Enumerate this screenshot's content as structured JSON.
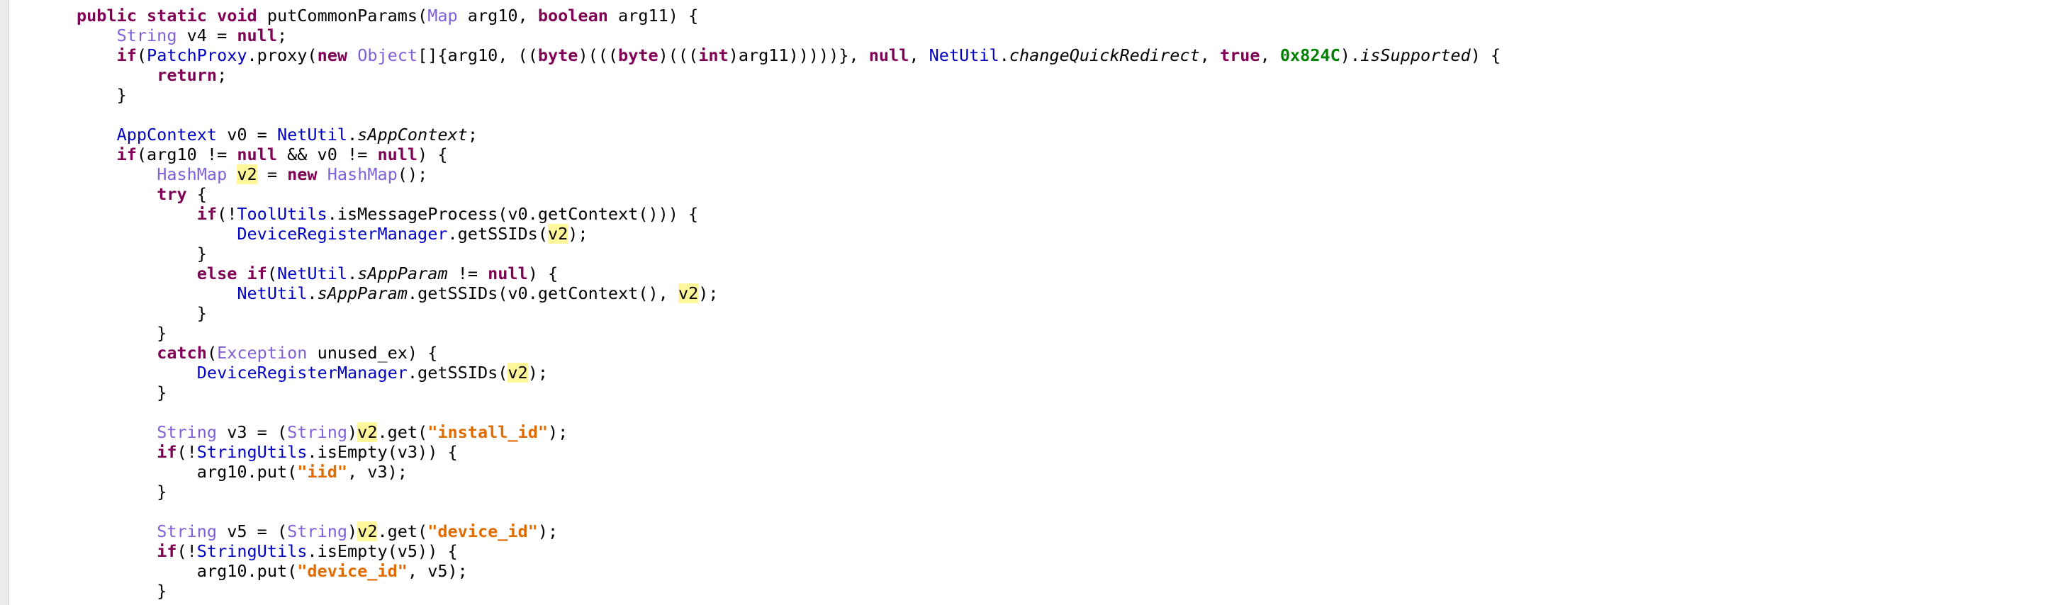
{
  "editor": {
    "lines": [
      [
        {
          "t": "public static void ",
          "c": "kw"
        },
        {
          "t": "putCommonParams("
        },
        {
          "t": "Map",
          "c": "ty"
        },
        {
          "t": " arg10, "
        },
        {
          "t": "boolean",
          "c": "kw"
        },
        {
          "t": " arg11) {"
        }
      ],
      [
        {
          "t": "    "
        },
        {
          "t": "String",
          "c": "ty"
        },
        {
          "t": " v4 = "
        },
        {
          "t": "null",
          "c": "kw"
        },
        {
          "t": ";"
        }
      ],
      [
        {
          "t": "    "
        },
        {
          "t": "if",
          "c": "kw"
        },
        {
          "t": "("
        },
        {
          "t": "PatchProxy",
          "c": "cls"
        },
        {
          "t": ".proxy("
        },
        {
          "t": "new",
          "c": "kw"
        },
        {
          "t": " "
        },
        {
          "t": "Object",
          "c": "ty"
        },
        {
          "t": "[]{arg10, (("
        },
        {
          "t": "byte",
          "c": "kw"
        },
        {
          "t": ")((("
        },
        {
          "t": "byte",
          "c": "kw"
        },
        {
          "t": ")((("
        },
        {
          "t": "int",
          "c": "kw"
        },
        {
          "t": ")arg11)))))}, "
        },
        {
          "t": "null",
          "c": "kw"
        },
        {
          "t": ", "
        },
        {
          "t": "NetUtil",
          "c": "cls"
        },
        {
          "t": "."
        },
        {
          "t": "changeQuickRedirect",
          "c": "it"
        },
        {
          "t": ", "
        },
        {
          "t": "true",
          "c": "kw"
        },
        {
          "t": ", "
        },
        {
          "t": "0x824C",
          "c": "num"
        },
        {
          "t": ")."
        },
        {
          "t": "isSupported",
          "c": "it"
        },
        {
          "t": ") {"
        }
      ],
      [
        {
          "t": "        "
        },
        {
          "t": "return",
          "c": "kw"
        },
        {
          "t": ";"
        }
      ],
      [
        {
          "t": "    }"
        }
      ],
      [
        {
          "t": ""
        }
      ],
      [
        {
          "t": "    "
        },
        {
          "t": "AppContext",
          "c": "cls"
        },
        {
          "t": " v0 = "
        },
        {
          "t": "NetUtil",
          "c": "cls"
        },
        {
          "t": "."
        },
        {
          "t": "sAppContext",
          "c": "it"
        },
        {
          "t": ";"
        }
      ],
      [
        {
          "t": "    "
        },
        {
          "t": "if",
          "c": "kw"
        },
        {
          "t": "(arg10 != "
        },
        {
          "t": "null",
          "c": "kw"
        },
        {
          "t": " && v0 != "
        },
        {
          "t": "null",
          "c": "kw"
        },
        {
          "t": ") {"
        }
      ],
      [
        {
          "t": "        "
        },
        {
          "t": "HashMap",
          "c": "ty"
        },
        {
          "t": " "
        },
        {
          "t": "v2",
          "c": "hl"
        },
        {
          "t": " = "
        },
        {
          "t": "new",
          "c": "kw"
        },
        {
          "t": " "
        },
        {
          "t": "HashMap",
          "c": "ty"
        },
        {
          "t": "();"
        }
      ],
      [
        {
          "t": "        "
        },
        {
          "t": "try",
          "c": "kw"
        },
        {
          "t": " {"
        }
      ],
      [
        {
          "t": "            "
        },
        {
          "t": "if",
          "c": "kw"
        },
        {
          "t": "(!"
        },
        {
          "t": "ToolUtils",
          "c": "cls"
        },
        {
          "t": ".isMessageProcess(v0.getContext())) {"
        }
      ],
      [
        {
          "t": "                "
        },
        {
          "t": "DeviceRegisterManager",
          "c": "cls"
        },
        {
          "t": ".getSSIDs("
        },
        {
          "t": "v2",
          "c": "hl"
        },
        {
          "t": ");"
        }
      ],
      [
        {
          "t": "            }"
        }
      ],
      [
        {
          "t": "            "
        },
        {
          "t": "else if",
          "c": "kw"
        },
        {
          "t": "("
        },
        {
          "t": "NetUtil",
          "c": "cls"
        },
        {
          "t": "."
        },
        {
          "t": "sAppParam",
          "c": "it"
        },
        {
          "t": " != "
        },
        {
          "t": "null",
          "c": "kw"
        },
        {
          "t": ") {"
        }
      ],
      [
        {
          "t": "                "
        },
        {
          "t": "NetUtil",
          "c": "cls"
        },
        {
          "t": "."
        },
        {
          "t": "sAppParam",
          "c": "it"
        },
        {
          "t": ".getSSIDs(v0.getContext(), "
        },
        {
          "t": "v2",
          "c": "hl"
        },
        {
          "t": ");"
        }
      ],
      [
        {
          "t": "            }"
        }
      ],
      [
        {
          "t": "        }"
        }
      ],
      [
        {
          "t": "        "
        },
        {
          "t": "catch",
          "c": "kw"
        },
        {
          "t": "("
        },
        {
          "t": "Exception",
          "c": "ty"
        },
        {
          "t": " unused_ex) {"
        }
      ],
      [
        {
          "t": "            "
        },
        {
          "t": "DeviceRegisterManager",
          "c": "cls"
        },
        {
          "t": ".getSSIDs("
        },
        {
          "t": "v2",
          "c": "hl"
        },
        {
          "t": ");"
        }
      ],
      [
        {
          "t": "        }"
        }
      ],
      [
        {
          "t": ""
        }
      ],
      [
        {
          "t": "        "
        },
        {
          "t": "String",
          "c": "ty"
        },
        {
          "t": " v3 = ("
        },
        {
          "t": "String",
          "c": "ty"
        },
        {
          "t": ")"
        },
        {
          "t": "v2",
          "c": "hl"
        },
        {
          "t": ".get("
        },
        {
          "t": "\"install_id\"",
          "c": "str"
        },
        {
          "t": ");"
        }
      ],
      [
        {
          "t": "        "
        },
        {
          "t": "if",
          "c": "kw"
        },
        {
          "t": "(!"
        },
        {
          "t": "StringUtils",
          "c": "cls"
        },
        {
          "t": ".isEmpty(v3)) {"
        }
      ],
      [
        {
          "t": "            arg10.put("
        },
        {
          "t": "\"iid\"",
          "c": "str"
        },
        {
          "t": ", v3);"
        }
      ],
      [
        {
          "t": "        }"
        }
      ],
      [
        {
          "t": ""
        }
      ],
      [
        {
          "t": "        "
        },
        {
          "t": "String",
          "c": "ty"
        },
        {
          "t": " v5 = ("
        },
        {
          "t": "String",
          "c": "ty"
        },
        {
          "t": ")"
        },
        {
          "t": "v2",
          "c": "hl"
        },
        {
          "t": ".get("
        },
        {
          "t": "\"device_id\"",
          "c": "str"
        },
        {
          "t": ");"
        }
      ],
      [
        {
          "t": "        "
        },
        {
          "t": "if",
          "c": "kw"
        },
        {
          "t": "(!"
        },
        {
          "t": "StringUtils",
          "c": "cls"
        },
        {
          "t": ".isEmpty(v5)) {"
        }
      ],
      [
        {
          "t": "            arg10.put("
        },
        {
          "t": "\"device_id\"",
          "c": "str"
        },
        {
          "t": ", v5);"
        }
      ],
      [
        {
          "t": "        }"
        }
      ]
    ]
  },
  "colors": {
    "keyword": "#7f0055",
    "type": "#8060d8",
    "class": "#0000c0",
    "string": "#e06c00",
    "number": "#008000",
    "highlight": "#fff59a",
    "gutter": "#ececec"
  }
}
